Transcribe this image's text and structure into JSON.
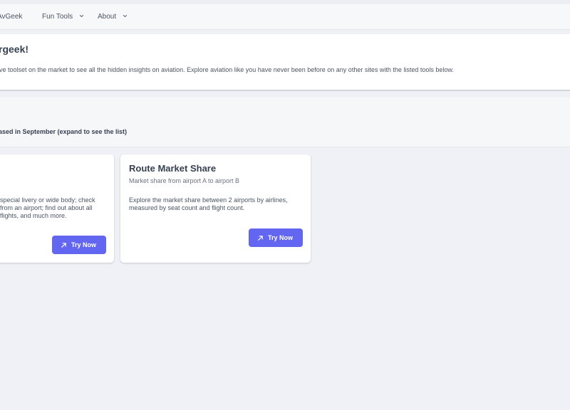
{
  "nav": {
    "brand": "AvGeek",
    "items": [
      {
        "label": "Fun Tools",
        "icon": "chevron-down-icon"
      },
      {
        "label": "About",
        "icon": "chevron-down-icon"
      }
    ]
  },
  "hero": {
    "title": "rgeek!",
    "description": "ve toolset on the market to see all the hidden insights on aviation. Explore aviation like you have never been before on any other sites with the listed tools below."
  },
  "section": {
    "label": "ased in September (expand to see the list)"
  },
  "cards": [
    {
      "title": "",
      "subtitle": "",
      "description_lines": [
        "special livery or wide body; check",
        "from an airport; find out about all",
        "flights, and much more."
      ],
      "button_label": "Try Now",
      "button_icon": "arrow-up-right-icon"
    },
    {
      "title": "Route Market Share",
      "subtitle": "Market share from airport A to airport B",
      "description_lines": [
        "Explore the market share between 2 airports by airlines,",
        "measured by seat count and flight count."
      ],
      "button_label": "Try Now",
      "button_icon": "arrow-up-right-icon"
    }
  ],
  "colors": {
    "accent": "#6366f1",
    "background": "#eff1f6",
    "card": "#ffffff",
    "text": "#374151"
  }
}
